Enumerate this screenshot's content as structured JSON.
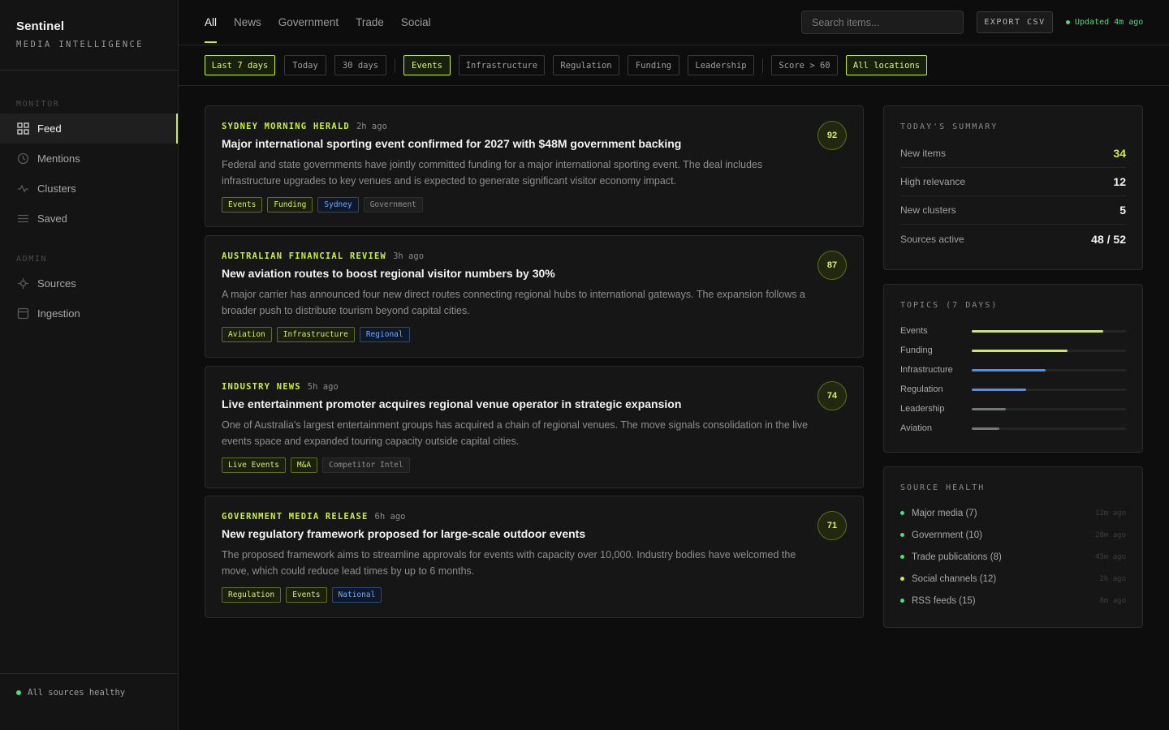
{
  "brand": {
    "name": "Sentinel",
    "subtitle": "MEDIA INTELLIGENCE"
  },
  "sidebar": {
    "sections": [
      {
        "label": "MONITOR",
        "items": [
          {
            "label": "Feed",
            "icon": "grid-icon",
            "active": true
          },
          {
            "label": "Mentions",
            "icon": "clock-icon",
            "active": false
          },
          {
            "label": "Clusters",
            "icon": "activity-icon",
            "active": false
          },
          {
            "label": "Saved",
            "icon": "list-icon",
            "active": false
          }
        ]
      },
      {
        "label": "ADMIN",
        "items": [
          {
            "label": "Sources",
            "icon": "target-icon",
            "active": false
          },
          {
            "label": "Ingestion",
            "icon": "database-icon",
            "active": false
          }
        ]
      }
    ],
    "footer_status": "All sources healthy"
  },
  "topbar": {
    "tabs": [
      "All",
      "News",
      "Government",
      "Trade",
      "Social"
    ],
    "active_tab": "All",
    "search_placeholder": "Search items...",
    "export_label": "EXPORT CSV",
    "updated_text": "Updated 4m ago"
  },
  "filters": {
    "time": [
      "Last 7 days",
      "Today",
      "30 days"
    ],
    "topics": [
      "Events",
      "Infrastructure",
      "Regulation",
      "Funding",
      "Leadership"
    ],
    "score": "Score > 60",
    "location": "All locations",
    "active": [
      "Last 7 days",
      "Events",
      "All locations"
    ]
  },
  "feed": [
    {
      "source": "SYDNEY MORNING HERALD",
      "time": "2h ago",
      "title": "Major international sporting event confirmed for 2027 with $48M government backing",
      "body": "Federal and state governments have jointly committed funding for a major international sporting event. The deal includes infrastructure upgrades to key venues and is expected to generate significant visitor economy impact.",
      "score": "92",
      "tags": [
        {
          "label": "Events",
          "color": "lime"
        },
        {
          "label": "Funding",
          "color": "lime"
        },
        {
          "label": "Sydney",
          "color": "blue"
        },
        {
          "label": "Government",
          "color": "gray"
        }
      ]
    },
    {
      "source": "AUSTRALIAN FINANCIAL REVIEW",
      "time": "3h ago",
      "title": "New aviation routes to boost regional visitor numbers by 30%",
      "body": "A major carrier has announced four new direct routes connecting regional hubs to international gateways. The expansion follows a broader push to distribute tourism beyond capital cities.",
      "score": "87",
      "tags": [
        {
          "label": "Aviation",
          "color": "lime"
        },
        {
          "label": "Infrastructure",
          "color": "lime"
        },
        {
          "label": "Regional",
          "color": "blue"
        }
      ]
    },
    {
      "source": "INDUSTRY NEWS",
      "time": "5h ago",
      "title": "Live entertainment promoter acquires regional venue operator in strategic expansion",
      "body": "One of Australia's largest entertainment groups has acquired a chain of regional venues. The move signals consolidation in the live events space and expanded touring capacity outside capital cities.",
      "score": "74",
      "tags": [
        {
          "label": "Live Events",
          "color": "lime"
        },
        {
          "label": "M&A",
          "color": "lime"
        },
        {
          "label": "Competitor Intel",
          "color": "gray"
        }
      ]
    },
    {
      "source": "GOVERNMENT MEDIA RELEASE",
      "time": "6h ago",
      "title": "New regulatory framework proposed for large-scale outdoor events",
      "body": "The proposed framework aims to streamline approvals for events with capacity over 10,000. Industry bodies have welcomed the move, which could reduce lead times by up to 6 months.",
      "score": "71",
      "tags": [
        {
          "label": "Regulation",
          "color": "lime"
        },
        {
          "label": "Events",
          "color": "lime"
        },
        {
          "label": "National",
          "color": "blue"
        }
      ]
    }
  ],
  "summary": {
    "title": "TODAY'S SUMMARY",
    "rows": [
      {
        "label": "New items",
        "value": "34",
        "highlight": true
      },
      {
        "label": "High relevance",
        "value": "12",
        "highlight": false
      },
      {
        "label": "New clusters",
        "value": "5",
        "highlight": false
      },
      {
        "label": "Sources active",
        "value": "48 / 52",
        "highlight": false
      }
    ]
  },
  "topics": {
    "title": "TOPICS (7 DAYS)",
    "rows": [
      {
        "label": "Events",
        "level": 0.85,
        "color": "#c6f135"
      },
      {
        "label": "Funding",
        "level": 0.62,
        "color": "#c6f135"
      },
      {
        "label": "Infrastructure",
        "level": 0.48,
        "color": "#4a90ff"
      },
      {
        "label": "Regulation",
        "level": 0.35,
        "color": "#4a90ff"
      },
      {
        "label": "Leadership",
        "level": 0.22,
        "color": "#777777"
      },
      {
        "label": "Aviation",
        "level": 0.18,
        "color": "#777777"
      }
    ]
  },
  "source_health": {
    "title": "SOURCE HEALTH",
    "rows": [
      {
        "label": "Major media (7)",
        "time": "12m ago",
        "status_color": "#4ade80"
      },
      {
        "label": "Government (10)",
        "time": "28m ago",
        "status_color": "#4ade80"
      },
      {
        "label": "Trade publications (8)",
        "time": "45m ago",
        "status_color": "#4ade80"
      },
      {
        "label": "Social channels (12)",
        "time": "2h ago",
        "status_color": "#c6f135"
      },
      {
        "label": "RSS feeds (15)",
        "time": "8m ago",
        "status_color": "#4ade80"
      }
    ]
  }
}
